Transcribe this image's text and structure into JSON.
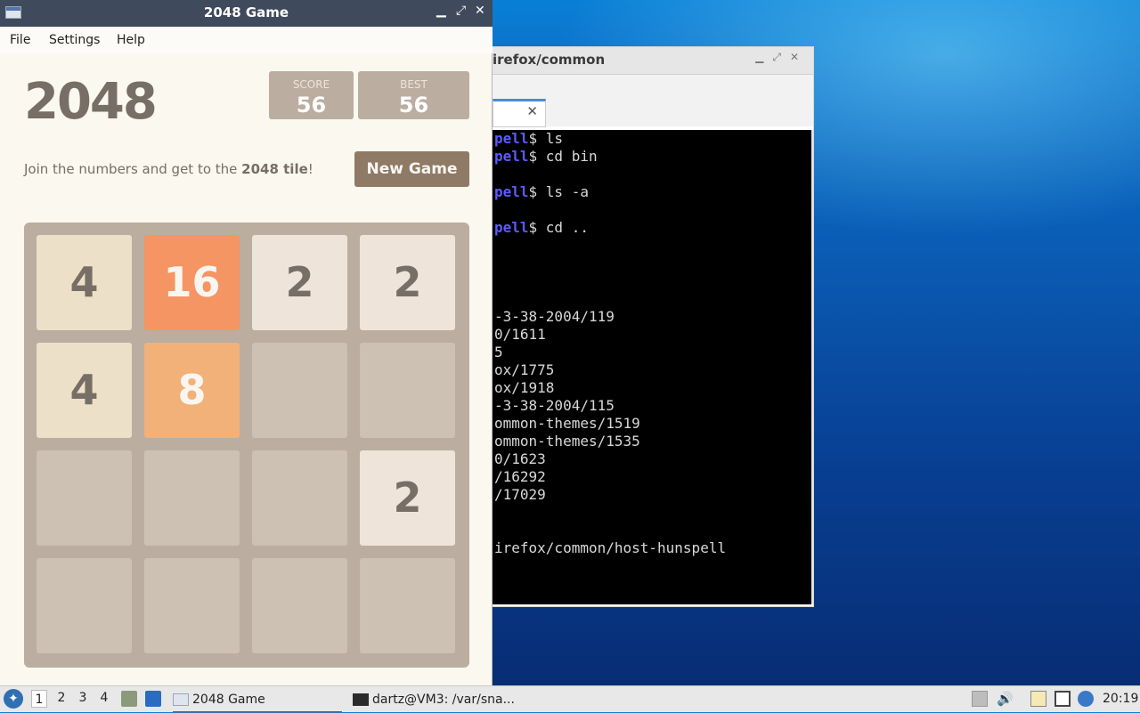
{
  "game_window": {
    "title": "2048 Game",
    "controls": {
      "minimize": "▁",
      "maximize": "⤢",
      "close": "✕"
    },
    "menu": [
      "File",
      "Settings",
      "Help"
    ],
    "heading": "2048",
    "score_label": "SCORE",
    "score_value": "56",
    "best_label": "BEST",
    "best_value": "56",
    "intro_text": "Join the numbers and get to the ",
    "intro_bold": "2048 tile",
    "intro_end": "!",
    "new_game_label": "New Game",
    "board": [
      [
        "4",
        "16",
        "2",
        "2"
      ],
      [
        "4",
        "8",
        "",
        ""
      ],
      [
        "",
        "",
        "",
        "2"
      ],
      [
        "",
        "",
        "",
        ""
      ]
    ],
    "tile_colors": {
      "2": {
        "bg": "#eee4da",
        "fg": "#776e65"
      },
      "4": {
        "bg": "#ede0c8",
        "fg": "#776e65"
      },
      "8": {
        "bg": "#f2b179",
        "fg": "#f9f6f2"
      },
      "16": {
        "bg": "#f59563",
        "fg": "#f9f6f2"
      }
    }
  },
  "terminal_window": {
    "title": "irefox/common",
    "tab_close": "✕",
    "lines": [
      {
        "prompt": "pell",
        "rest": "$ ls"
      },
      {
        "prompt": "pell",
        "rest": "$ cd bin"
      },
      {
        "prompt": "",
        "rest": ""
      },
      {
        "prompt": "pell",
        "rest": "$ ls -a"
      },
      {
        "prompt": "",
        "rest": ""
      },
      {
        "prompt": "pell",
        "rest": "$ cd .."
      },
      {
        "prompt": "",
        "rest": ""
      },
      {
        "prompt": "",
        "rest": ""
      },
      {
        "prompt": "",
        "rest": ""
      },
      {
        "prompt": "",
        "rest": ""
      },
      {
        "prompt": "",
        "rest": "-3-38-2004/119"
      },
      {
        "prompt": "",
        "rest": "0/1611"
      },
      {
        "prompt": "",
        "rest": "5"
      },
      {
        "prompt": "",
        "rest": "ox/1775"
      },
      {
        "prompt": "",
        "rest": "ox/1918"
      },
      {
        "prompt": "",
        "rest": "-3-38-2004/115"
      },
      {
        "prompt": "",
        "rest": "ommon-themes/1519"
      },
      {
        "prompt": "",
        "rest": "ommon-themes/1535"
      },
      {
        "prompt": "",
        "rest": "0/1623"
      },
      {
        "prompt": "",
        "rest": "/16292"
      },
      {
        "prompt": "",
        "rest": "/17029"
      },
      {
        "prompt": "",
        "rest": ""
      },
      {
        "prompt": "",
        "rest": ""
      },
      {
        "prompt": "",
        "rest": "irefox/common/host-hunspell"
      }
    ]
  },
  "taskbar": {
    "workspaces": [
      "1",
      "2",
      "3",
      "4"
    ],
    "tasks": [
      {
        "label": "2048 Game",
        "active": true
      },
      {
        "label": "dartz@VM3: /var/sna...",
        "active": false
      }
    ],
    "clock": "20:19"
  }
}
